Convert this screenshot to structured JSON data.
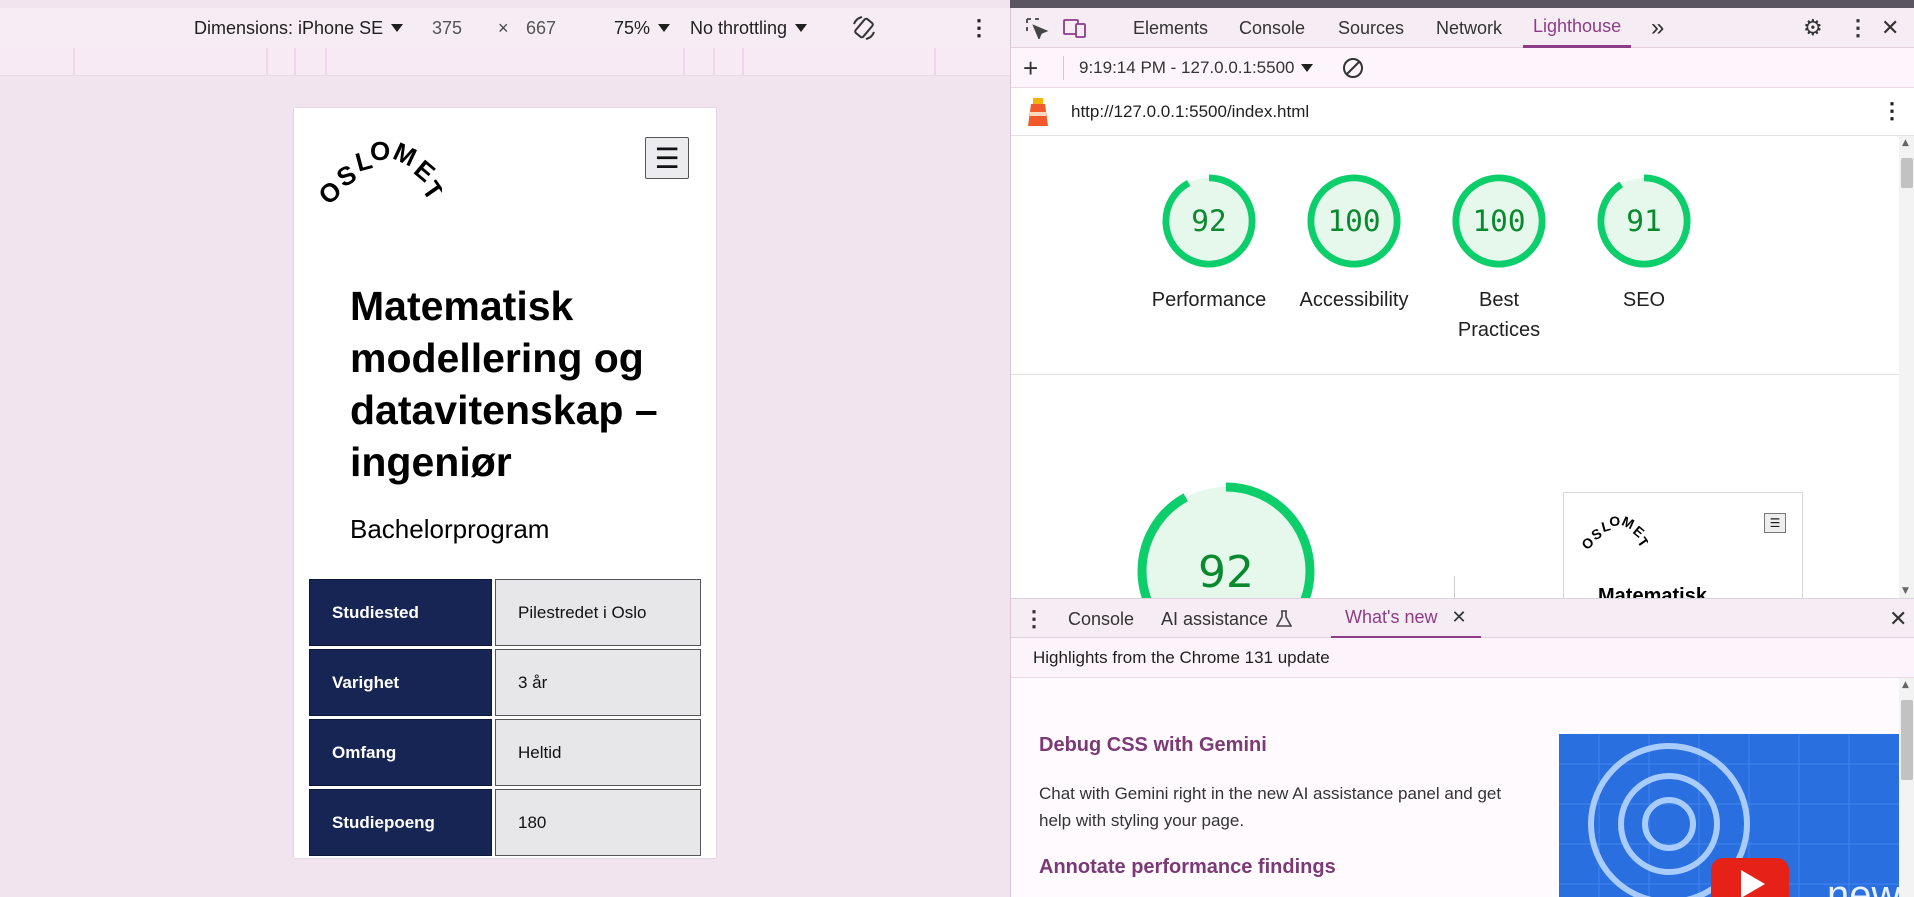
{
  "device_toolbar": {
    "dimensions_label": "Dimensions: iPhone SE",
    "width": "375",
    "times": "×",
    "height": "667",
    "zoom": "75%",
    "throttling": "No throttling"
  },
  "emulated_page": {
    "logo_text": "OSLOMET",
    "menu_glyph": "☰",
    "title": "Matematisk modellering og datavitenskap – ingeniør",
    "subtitle": "Bachelorprogram",
    "table": [
      {
        "key": "Studiested",
        "value": "Pilestredet i Oslo"
      },
      {
        "key": "Varighet",
        "value": "3 år"
      },
      {
        "key": "Omfang",
        "value": "Heltid"
      },
      {
        "key": "Studiepoeng",
        "value": "180"
      }
    ]
  },
  "devtools": {
    "tabs": [
      "Elements",
      "Console",
      "Sources",
      "Network",
      "Lighthouse"
    ],
    "active_tab": "Lighthouse",
    "more_tabs_glyph": "»",
    "lighthouse_toolbar": {
      "add_glyph": "+",
      "report_selector": "9:19:14 PM - 127.0.0.1:5500"
    },
    "url": "http://127.0.0.1:5500/index.html",
    "scores": [
      {
        "label": "Performance",
        "value": 92
      },
      {
        "label": "Accessibility",
        "value": 100
      },
      {
        "label": "Best Practices",
        "value": 100
      },
      {
        "label": "SEO",
        "value": 91
      }
    ],
    "big_score": {
      "value": 92
    },
    "thumbnail": {
      "logo_text": "OSLOMET",
      "heading": "Matematisk"
    },
    "score_color": "#0cce6b",
    "score_text_color": "#0a8a2e",
    "accent": "#8c3d86"
  },
  "drawer": {
    "tabs": [
      "Console",
      "AI assistance",
      "What's new"
    ],
    "active_tab": "What's new",
    "header": "Highlights from the Chrome 131 update",
    "sections": [
      {
        "heading": "Debug CSS with Gemini",
        "text": "Chat with Gemini right in the new AI assistance panel and get help with styling your page."
      },
      {
        "heading": "Annotate performance findings"
      }
    ],
    "image_text": "new"
  }
}
